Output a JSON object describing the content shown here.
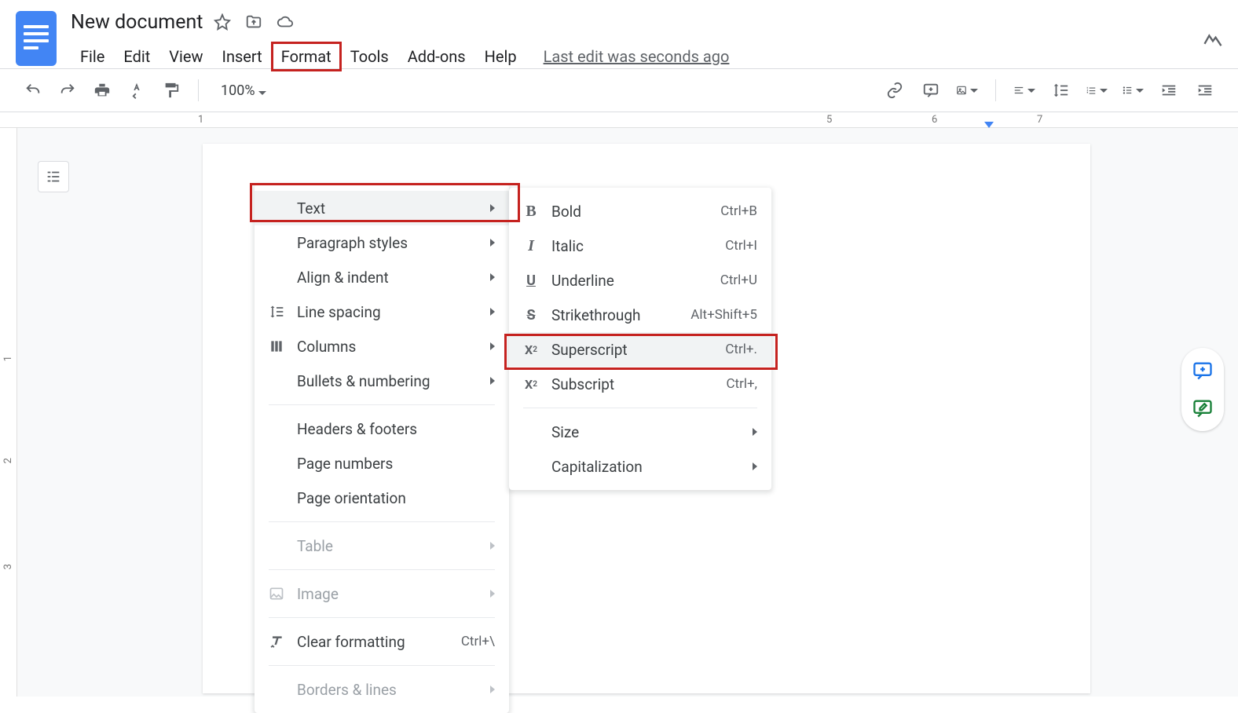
{
  "header": {
    "title": "New document",
    "last_edit": "Last edit was seconds ago"
  },
  "menubar": {
    "file": "File",
    "edit": "Edit",
    "view": "View",
    "insert": "Insert",
    "format": "Format",
    "tools": "Tools",
    "addons": "Add-ons",
    "help": "Help"
  },
  "toolbar": {
    "zoom": "100%"
  },
  "ruler": {
    "h": [
      "1",
      "5",
      "6",
      "7"
    ],
    "v": [
      "1",
      "2",
      "3"
    ]
  },
  "format_menu": {
    "text": "Text",
    "paragraph": "Paragraph styles",
    "align": "Align & indent",
    "linespacing": "Line spacing",
    "columns": "Columns",
    "bullets": "Bullets & numbering",
    "headers": "Headers & footers",
    "pagenum": "Page numbers",
    "pageorient": "Page orientation",
    "table": "Table",
    "image": "Image",
    "clear": "Clear formatting",
    "clear_sc": "Ctrl+\\",
    "borders": "Borders & lines"
  },
  "text_submenu": {
    "bold": "Bold",
    "bold_sc": "Ctrl+B",
    "italic": "Italic",
    "italic_sc": "Ctrl+I",
    "underline": "Underline",
    "underline_sc": "Ctrl+U",
    "strike": "Strikethrough",
    "strike_sc": "Alt+Shift+5",
    "super": "Superscript",
    "super_sc": "Ctrl+.",
    "sub": "Subscript",
    "sub_sc": "Ctrl+,",
    "size": "Size",
    "cap": "Capitalization"
  }
}
